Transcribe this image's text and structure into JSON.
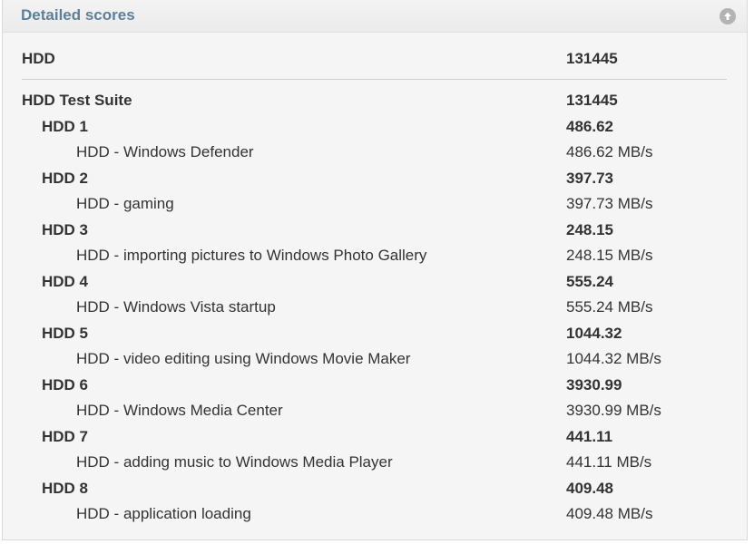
{
  "panel": {
    "title": "Detailed scores",
    "collapse_icon": "arrow-up-circle-icon"
  },
  "summary": {
    "label": "HDD",
    "value": "131445"
  },
  "suite": {
    "label": "HDD Test Suite",
    "value": "131445"
  },
  "groups": [
    {
      "label": "HDD 1",
      "value": "486.62",
      "test_label": "HDD - Windows Defender",
      "test_value": "486.62 MB/s"
    },
    {
      "label": "HDD 2",
      "value": "397.73",
      "test_label": "HDD - gaming",
      "test_value": "397.73 MB/s"
    },
    {
      "label": "HDD 3",
      "value": "248.15",
      "test_label": "HDD - importing pictures to Windows Photo Gallery",
      "test_value": "248.15 MB/s"
    },
    {
      "label": "HDD 4",
      "value": "555.24",
      "test_label": "HDD - Windows Vista startup",
      "test_value": "555.24 MB/s"
    },
    {
      "label": "HDD 5",
      "value": "1044.32",
      "test_label": "HDD - video editing using Windows Movie Maker",
      "test_value": "1044.32 MB/s"
    },
    {
      "label": "HDD 6",
      "value": "3930.99",
      "test_label": "HDD - Windows Media Center",
      "test_value": "3930.99 MB/s"
    },
    {
      "label": "HDD 7",
      "value": "441.11",
      "test_label": "HDD - adding music to Windows Media Player",
      "test_value": "441.11 MB/s"
    },
    {
      "label": "HDD 8",
      "value": "409.48",
      "test_label": "HDD - application loading",
      "test_value": "409.48 MB/s"
    }
  ]
}
